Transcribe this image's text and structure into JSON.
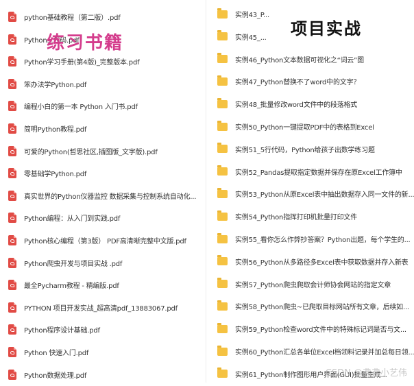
{
  "left_files": [
    "python基础教程（第二版）.pdf",
    "Python...代码.pdf",
    "Python学习手册(第4版)_完整版本.pdf",
    "笨办法学Python.pdf",
    "编程小白的第一本 Python 入门书.pdf",
    "简明Python教程.pdf",
    "可爱的Python(哲思社区,插图版_文字版).pdf",
    "零基础学Python.pdf",
    "真实世界的Python仪器监控 数据采集与控制系统自动化...",
    "Python编程：从入门到实践.pdf",
    "Python核心编程（第3版） PDF高清晰完整中文版.pdf",
    "Python爬虫开发与项目实战 .pdf",
    "最全Pycharm教程 - 精编版.pdf",
    "PYTHON 项目开发实战_超高清pdf_13883067.pdf",
    "Python程序设计基础.pdf",
    "Python 快速入门.pdf",
    "Python数据处理.pdf"
  ],
  "right_folders": [
    "实例43_P...",
    "实例45_...",
    "实例46_Python文本数据可视化之“词云”图",
    "实例47_Python替换不了word中的文字？",
    "实例48_批量修改word文件中的段落格式",
    "实例50_Python一键提取PDF中的表格到Excel",
    "实例51_5行代码，Python给孩子出数学练习题",
    "实例52_Pandas提取指定数据并保存在原Excel工作簿中",
    "实例53_Python从原Excel表中抽出数据存入同一文件的新...",
    "实例54_Python指挥打印机批量打印文件",
    "实例55_看你怎么作弊抄答案？Python出题，每个学生的...",
    "实例56_Python从多路径多Excel表中获取数据并存入新表",
    "实例57_Python爬虫爬取会计师协会网站的指定文章",
    "实例58_Python爬虫~已爬取目标网站所有文章，后续如...",
    "实例59_Python检查word文件中的特殊标记词是否与文...",
    "实例60_Python汇总各单位Excel档领料记录并加总每日领...",
    "实例61_Python制作图形用户界面(GUI)批量生成..."
  ],
  "overlay": {
    "left_title": "练习书籍",
    "right_title": "项目实战",
    "watermark": "CSDN @弗弗小艺伟"
  }
}
